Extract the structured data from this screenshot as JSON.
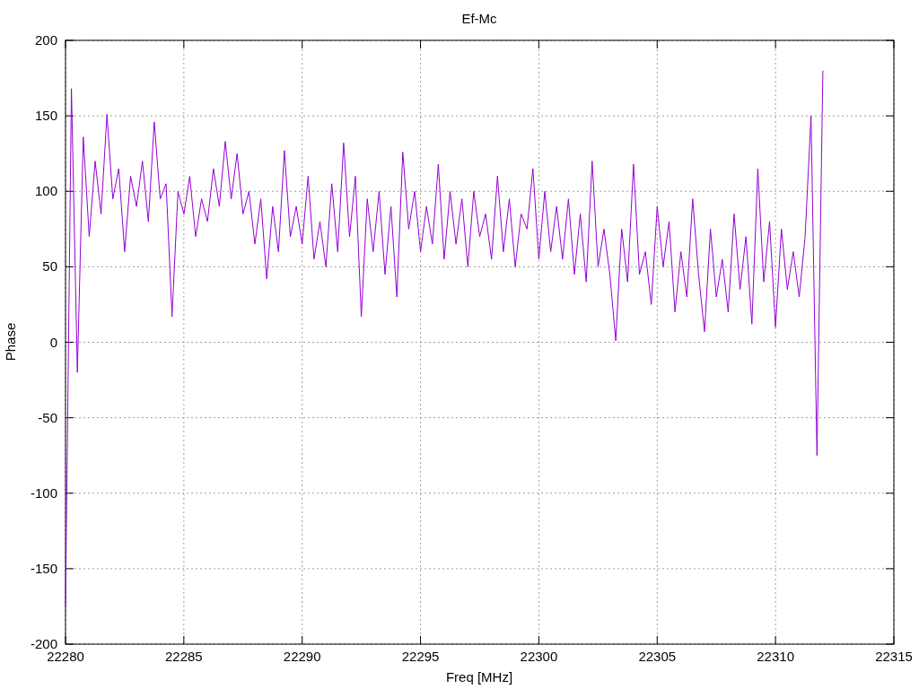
{
  "chart_data": {
    "type": "line",
    "title": "Ef-Mc",
    "xlabel": "Freq [MHz]",
    "ylabel": "Phase",
    "x": [
      22280,
      22280.25,
      22280.5,
      22280.75,
      22281,
      22281.25,
      22281.5,
      22281.75,
      22282,
      22282.25,
      22282.5,
      22282.75,
      22283,
      22283.25,
      22283.5,
      22283.75,
      22284,
      22284.25,
      22284.5,
      22284.75,
      22285,
      22285.25,
      22285.5,
      22285.75,
      22286,
      22286.25,
      22286.5,
      22286.75,
      22287,
      22287.25,
      22287.5,
      22287.75,
      22288,
      22288.25,
      22288.5,
      22288.75,
      22289,
      22289.25,
      22289.5,
      22289.75,
      22290,
      22290.25,
      22290.5,
      22290.75,
      22291,
      22291.25,
      22291.5,
      22291.75,
      22292,
      22292.25,
      22292.5,
      22292.75,
      22293,
      22293.25,
      22293.5,
      22293.75,
      22294,
      22294.25,
      22294.5,
      22294.75,
      22295,
      22295.25,
      22295.5,
      22295.75,
      22296,
      22296.25,
      22296.5,
      22296.75,
      22297,
      22297.25,
      22297.5,
      22297.75,
      22298,
      22298.25,
      22298.5,
      22298.75,
      22299,
      22299.25,
      22299.5,
      22299.75,
      22300,
      22300.25,
      22300.5,
      22300.75,
      22301,
      22301.25,
      22301.5,
      22301.75,
      22302,
      22302.25,
      22302.5,
      22302.75,
      22303,
      22303.25,
      22303.5,
      22303.75,
      22304,
      22304.25,
      22304.5,
      22304.75,
      22305,
      22305.25,
      22305.5,
      22305.75,
      22306,
      22306.25,
      22306.5,
      22306.75,
      22307,
      22307.25,
      22307.5,
      22307.75,
      22308,
      22308.25,
      22308.5,
      22308.75,
      22309,
      22309.25,
      22309.5,
      22309.75,
      22310,
      22310.25,
      22310.5,
      22310.75,
      22311,
      22311.25,
      22311.5,
      22311.75,
      22312
    ],
    "series": [
      {
        "color": "#9400d3",
        "values": [
          -175,
          168,
          -20,
          136,
          70,
          120,
          85,
          151,
          95,
          115,
          60,
          110,
          90,
          120,
          80,
          146,
          95,
          105,
          17,
          100,
          85,
          110,
          70,
          95,
          80,
          115,
          90,
          133,
          95,
          125,
          85,
          100,
          65,
          95,
          42,
          90,
          60,
          127,
          70,
          90,
          65,
          110,
          55,
          80,
          50,
          105,
          60,
          132,
          70,
          110,
          17,
          95,
          60,
          100,
          45,
          90,
          30,
          126,
          75,
          100,
          60,
          90,
          65,
          118,
          55,
          100,
          65,
          95,
          50,
          100,
          70,
          85,
          55,
          110,
          60,
          95,
          50,
          85,
          75,
          115,
          55,
          100,
          60,
          90,
          55,
          95,
          45,
          85,
          40,
          120,
          50,
          75,
          45,
          1,
          75,
          40,
          118,
          45,
          60,
          25,
          90,
          50,
          80,
          20,
          60,
          30,
          95,
          45,
          7,
          75,
          30,
          55,
          20,
          85,
          35,
          70,
          12,
          115,
          40,
          80,
          10,
          75,
          35,
          60,
          30,
          70,
          150,
          -75,
          180
        ]
      }
    ],
    "xlim": [
      22280,
      22315
    ],
    "ylim": [
      -200,
      200
    ],
    "xticks": [
      22280,
      22285,
      22290,
      22295,
      22300,
      22305,
      22310,
      22315
    ],
    "yticks": [
      -200,
      -150,
      -100,
      -50,
      0,
      50,
      100,
      150,
      200
    ],
    "grid": true
  }
}
